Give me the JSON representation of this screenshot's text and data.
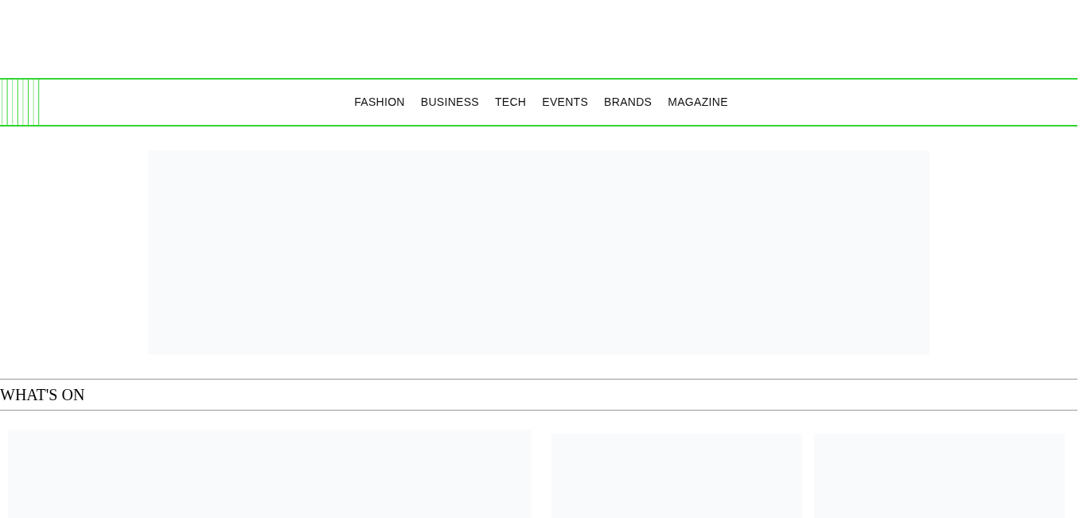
{
  "nav": {
    "items": [
      {
        "label": "FASHION"
      },
      {
        "label": "BUSINESS"
      },
      {
        "label": "TECH"
      },
      {
        "label": "EVENTS"
      },
      {
        "label": "BRANDS"
      },
      {
        "label": "MAGAZINE"
      }
    ]
  },
  "section": {
    "title": "WHAT'S ON"
  }
}
